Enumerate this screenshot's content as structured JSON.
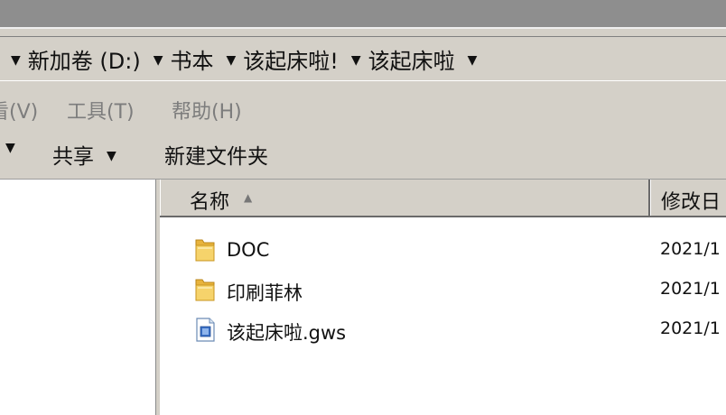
{
  "address": {
    "crumbs": [
      "新加卷 (D:)",
      "书本",
      "该起床啦!",
      "该起床啦"
    ]
  },
  "menu": {
    "view": "看(V)",
    "tools": "工具(T)",
    "help": "帮助(H)"
  },
  "toolbar": {
    "share": "共享",
    "new_folder": "新建文件夹"
  },
  "columns": {
    "name": "名称",
    "modified": "修改日"
  },
  "files": [
    {
      "name": "DOC",
      "type": "folder",
      "date": "2021/1"
    },
    {
      "name": "印刷菲林",
      "type": "folder",
      "date": "2021/1"
    },
    {
      "name": "该起床啦.gws",
      "type": "file",
      "date": "2021/1"
    }
  ],
  "icons": {
    "breadcrumb_arrow": "chevron-down-icon",
    "folder": "folder-icon",
    "file": "document-icon",
    "sort": "sort-ascending-icon"
  }
}
